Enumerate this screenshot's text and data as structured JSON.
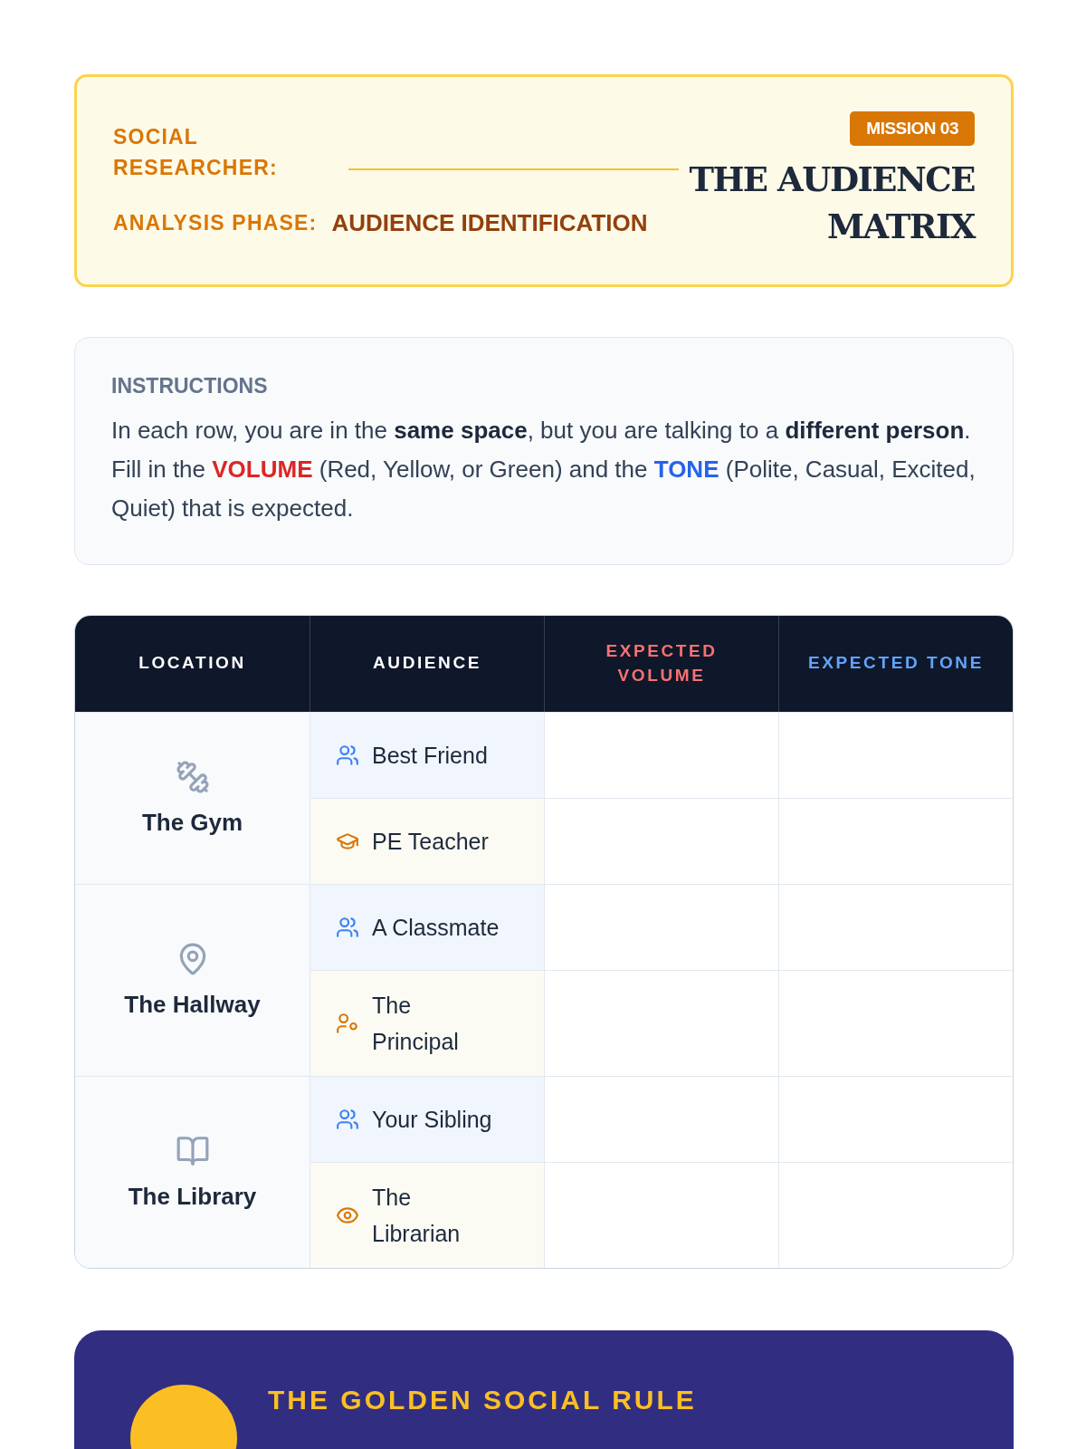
{
  "header": {
    "researcher_label": "SOCIAL RESEARCHER:",
    "phase_label": "ANALYSIS PHASE:",
    "phase_value": "AUDIENCE IDENTIFICATION",
    "badge": "MISSION 03",
    "title": "THE AUDIENCE MATRIX"
  },
  "instructions": {
    "heading": "INSTRUCTIONS",
    "segments": [
      {
        "kind": "plain",
        "text": "In each row, you are in the **same space**, but you are talking to a **different person**. Fill in the "
      },
      {
        "kind": "volume",
        "text": "VOLUME"
      },
      {
        "kind": "plain",
        "text": " (Red, Yellow, or Green) and the "
      },
      {
        "kind": "tone",
        "text": "TONE"
      },
      {
        "kind": "plain",
        "text": " (Polite, Casual, Excited, Quiet) that is expected."
      }
    ]
  },
  "table": {
    "columns": [
      {
        "label": "LOCATION",
        "kind": "plain"
      },
      {
        "label": "AUDIENCE",
        "kind": "plain"
      },
      {
        "label": "EXPECTED VOLUME",
        "kind": "volume"
      },
      {
        "label": "EXPECTED TONE",
        "kind": "tone"
      }
    ],
    "locations": [
      {
        "name": "The Gym",
        "audiences": [
          {
            "name": "Best Friend",
            "kind": "peer"
          },
          {
            "name": "PE Teacher",
            "kind": "adult"
          }
        ]
      },
      {
        "name": "The Hallway",
        "audiences": [
          {
            "name": "A Classmate",
            "kind": "peer"
          },
          {
            "name": "The Principal",
            "kind": "adult"
          }
        ]
      },
      {
        "name": "The Library",
        "audiences": [
          {
            "name": "Your Sibling",
            "kind": "peer"
          },
          {
            "name": "The Librarian",
            "kind": "adult"
          }
        ]
      }
    ]
  },
  "rule_panel": {
    "title": "THE GOLDEN SOCIAL RULE"
  }
}
